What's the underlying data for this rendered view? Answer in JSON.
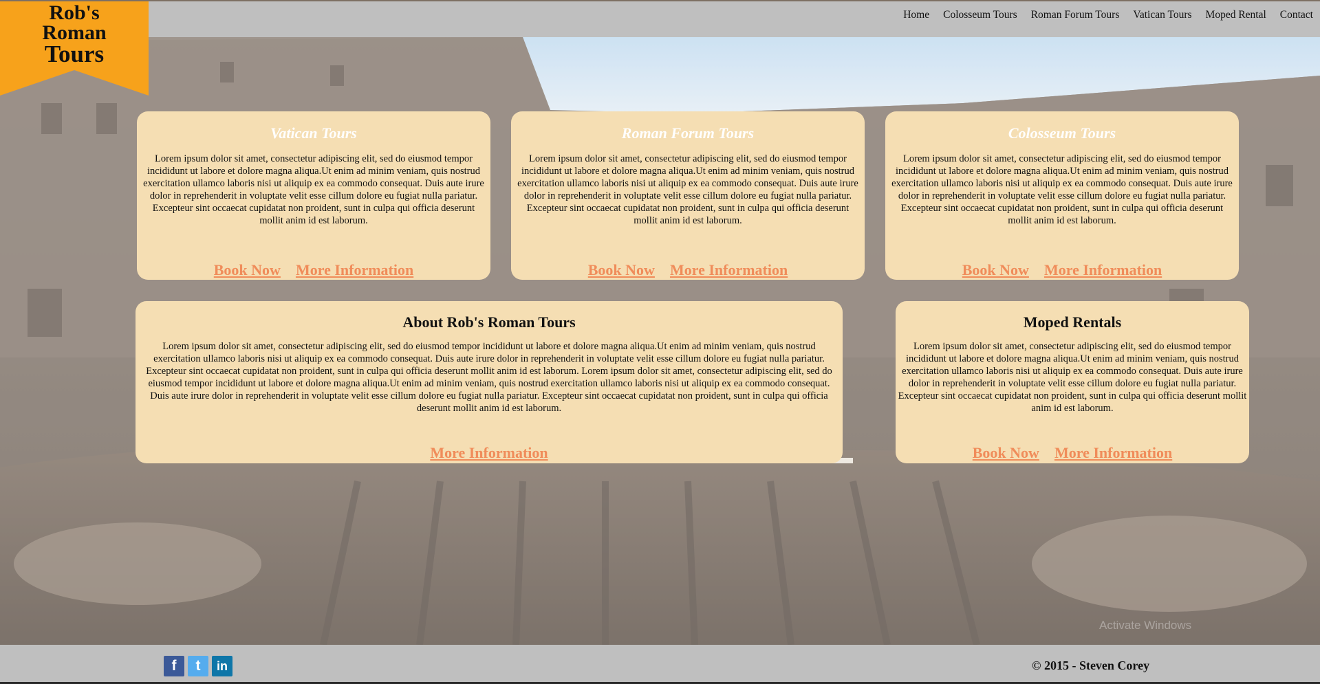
{
  "brand": {
    "line1": "Rob's",
    "line2": "Roman",
    "line3": "Tours",
    "color": "#f7a21b"
  },
  "nav": {
    "items": [
      "Home",
      "Colosseum Tours",
      "Roman Forum Tours",
      "Vatican Tours",
      "Moped Rental",
      "Contact"
    ]
  },
  "lorem_short": "Lorem ipsum dolor sit amet, consectetur adipiscing elit, sed do eiusmod tempor incididunt ut labore et dolore magna aliqua.Ut enim ad minim veniam, quis nostrud exercitation ullamco laboris nisi ut aliquip ex ea commodo consequat. Duis aute irure dolor in reprehenderit in voluptate velit esse cillum dolore eu fugiat nulla pariatur. Excepteur sint occaecat cupidatat non proident, sunt in culpa qui officia deserunt mollit anim id est laborum.",
  "lorem_long": "Lorem ipsum dolor sit amet, consectetur adipiscing elit, sed do eiusmod tempor incididunt ut labore et dolore magna aliqua.Ut enim ad minim veniam, quis nostrud exercitation ullamco laboris nisi ut aliquip ex ea commodo consequat. Duis aute irure dolor in reprehenderit in voluptate velit esse cillum dolore eu fugiat nulla pariatur. Excepteur sint occaecat cupidatat non proident, sunt in culpa qui officia deserunt mollit anim id est laborum. Lorem ipsum dolor sit amet, consectetur adipiscing elit, sed do eiusmod tempor incididunt ut labore et dolore magna aliqua.Ut enim ad minim veniam, quis nostrud exercitation ullamco laboris nisi ut aliquip ex ea commodo consequat. Duis aute irure dolor in reprehenderit in voluptate velit esse cillum dolore eu fugiat nulla pariatur. Excepteur sint occaecat cupidatat non proident, sunt in culpa qui officia deserunt mollit anim id est laborum.",
  "cards": {
    "vatican": {
      "title": "Vatican Tours",
      "book": "Book Now",
      "more": "More Information"
    },
    "forum": {
      "title": "Roman Forum Tours",
      "book": "Book Now",
      "more": "More Information"
    },
    "colosseum": {
      "title": "Colosseum Tours",
      "book": "Book Now",
      "more": "More Information"
    },
    "about": {
      "title": "About Rob's Roman Tours",
      "more": "More Information"
    },
    "moped": {
      "title": "Moped Rentals",
      "book": "Book Now",
      "more": "More Information"
    }
  },
  "footer": {
    "copyright": "© 2015 - Steven Corey",
    "social": [
      {
        "icon": "facebook-icon",
        "glyph": "f",
        "color": "#3b5998"
      },
      {
        "icon": "twitter-icon",
        "glyph": "t",
        "color": "#55acee"
      },
      {
        "icon": "linkedin-icon",
        "glyph": "in",
        "color": "#0e76a8"
      }
    ]
  },
  "watermark": "Activate Windows",
  "colors": {
    "card_bg": "#f5deb3",
    "link": "#f08c5a",
    "header_bg": "#bfbfbf"
  }
}
